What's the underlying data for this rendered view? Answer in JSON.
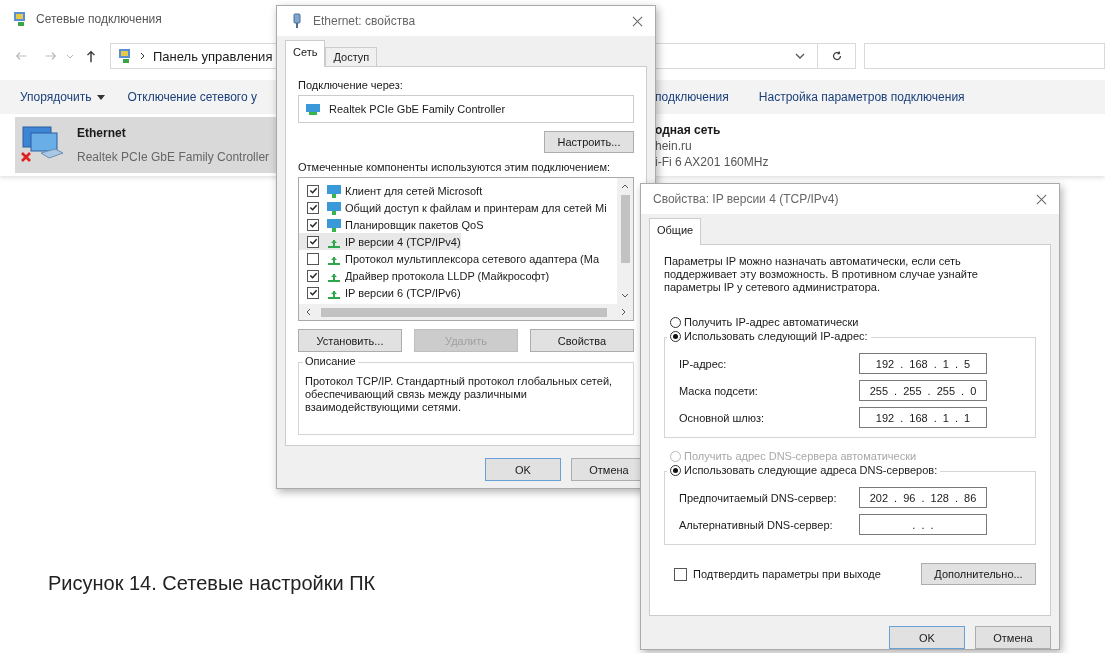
{
  "explorer": {
    "title": "Сетевые подключения",
    "address": "Панель управления",
    "toolbar": [
      {
        "label": "Упорядочить",
        "dropdown": true
      },
      {
        "label": "Отключение сетевого у",
        "dropdown": false
      }
    ],
    "toolbar_right": [
      "подключения",
      "Настройка параметров подключения"
    ],
    "item": {
      "name": "Ethernet",
      "device": "Realtek PCIe GbE Family Controller",
      "selected": true,
      "disconnected": true
    },
    "item_right": [
      "одная сеть",
      "hein.ru",
      "i-Fi 6 AX201 160MHz"
    ]
  },
  "ethernet_dialog": {
    "title": "Ethernet: свойства",
    "tabs": [
      {
        "label": "Сеть",
        "selected": true
      },
      {
        "label": "Доступ",
        "selected": false
      }
    ],
    "connect_label": "Подключение через:",
    "adapter": "Realtek PCIe GbE Family Controller",
    "configure_button": "Настроить...",
    "components_label": "Отмеченные компоненты используются этим подключением:",
    "components": [
      {
        "label": "Клиент для сетей Microsoft",
        "checked": true,
        "selected": false,
        "kind": "service"
      },
      {
        "label": "Общий доступ к файлам и принтерам для сетей Mi",
        "checked": true,
        "selected": false,
        "kind": "service"
      },
      {
        "label": "Планировщик пакетов QoS",
        "checked": true,
        "selected": false,
        "kind": "service"
      },
      {
        "label": "IP версии 4 (TCP/IPv4)",
        "checked": true,
        "selected": true,
        "kind": "protocol"
      },
      {
        "label": "Протокол мультиплексора сетевого адаптера (Ма",
        "checked": false,
        "selected": false,
        "kind": "protocol"
      },
      {
        "label": "Драйвер протокола LLDP (Майкрософт)",
        "checked": true,
        "selected": false,
        "kind": "protocol"
      },
      {
        "label": "IP версии 6 (TCP/IPv6)",
        "checked": true,
        "selected": false,
        "kind": "protocol"
      }
    ],
    "buttons": [
      {
        "label": "Установить...",
        "disabled": false
      },
      {
        "label": "Удалить",
        "disabled": true
      },
      {
        "label": "Свойства",
        "disabled": false
      }
    ],
    "description_title": "Описание",
    "description": "Протокол TCP/IP. Стандартный протокол глобальных сетей, обеспечивающий связь между различными взаимодействующими сетями.",
    "footer_buttons": [
      "OK",
      "Отмена"
    ]
  },
  "ipv4_dialog": {
    "title": "Свойства: IP версии 4 (TCP/IPv4)",
    "tabs": [
      {
        "label": "Общие",
        "selected": true
      }
    ],
    "intro": "Параметры IP можно назначать автоматически, если сеть поддерживает эту возможность. В противном случае узнайте параметры IP у сетевого администратора.",
    "ip_options": [
      {
        "label": "Получить IP-адрес автоматически",
        "selected": false,
        "disabled": false
      },
      {
        "label": "Использовать следующий IP-адрес:",
        "selected": true,
        "disabled": false
      }
    ],
    "ip_fields": [
      {
        "label": "IP-адрес:",
        "value": "192 . 168 . 1 . 5"
      },
      {
        "label": "Маска подсети:",
        "value": "255 . 255 . 255 . 0"
      },
      {
        "label": "Основной шлюз:",
        "value": "192 . 168 . 1 . 1"
      }
    ],
    "dns_options": [
      {
        "label": "Получить адрес DNS-сервера автоматически",
        "selected": false,
        "disabled": true
      },
      {
        "label": "Использовать следующие адреса DNS-серверов:",
        "selected": true,
        "disabled": false
      }
    ],
    "dns_fields": [
      {
        "label": "Предпочитаемый DNS-сервер:",
        "value": "202 . 96 . 128 . 86"
      },
      {
        "label": "Альтернативный DNS-сервер:",
        "value": ". . ."
      }
    ],
    "validate": {
      "label": "Подтвердить параметры при выходе",
      "checked": false
    },
    "advanced_button": "Дополнительно...",
    "footer_buttons": [
      "OK",
      "Отмена"
    ]
  },
  "caption": "Рисунок 14. Сетевые настройки ПК"
}
